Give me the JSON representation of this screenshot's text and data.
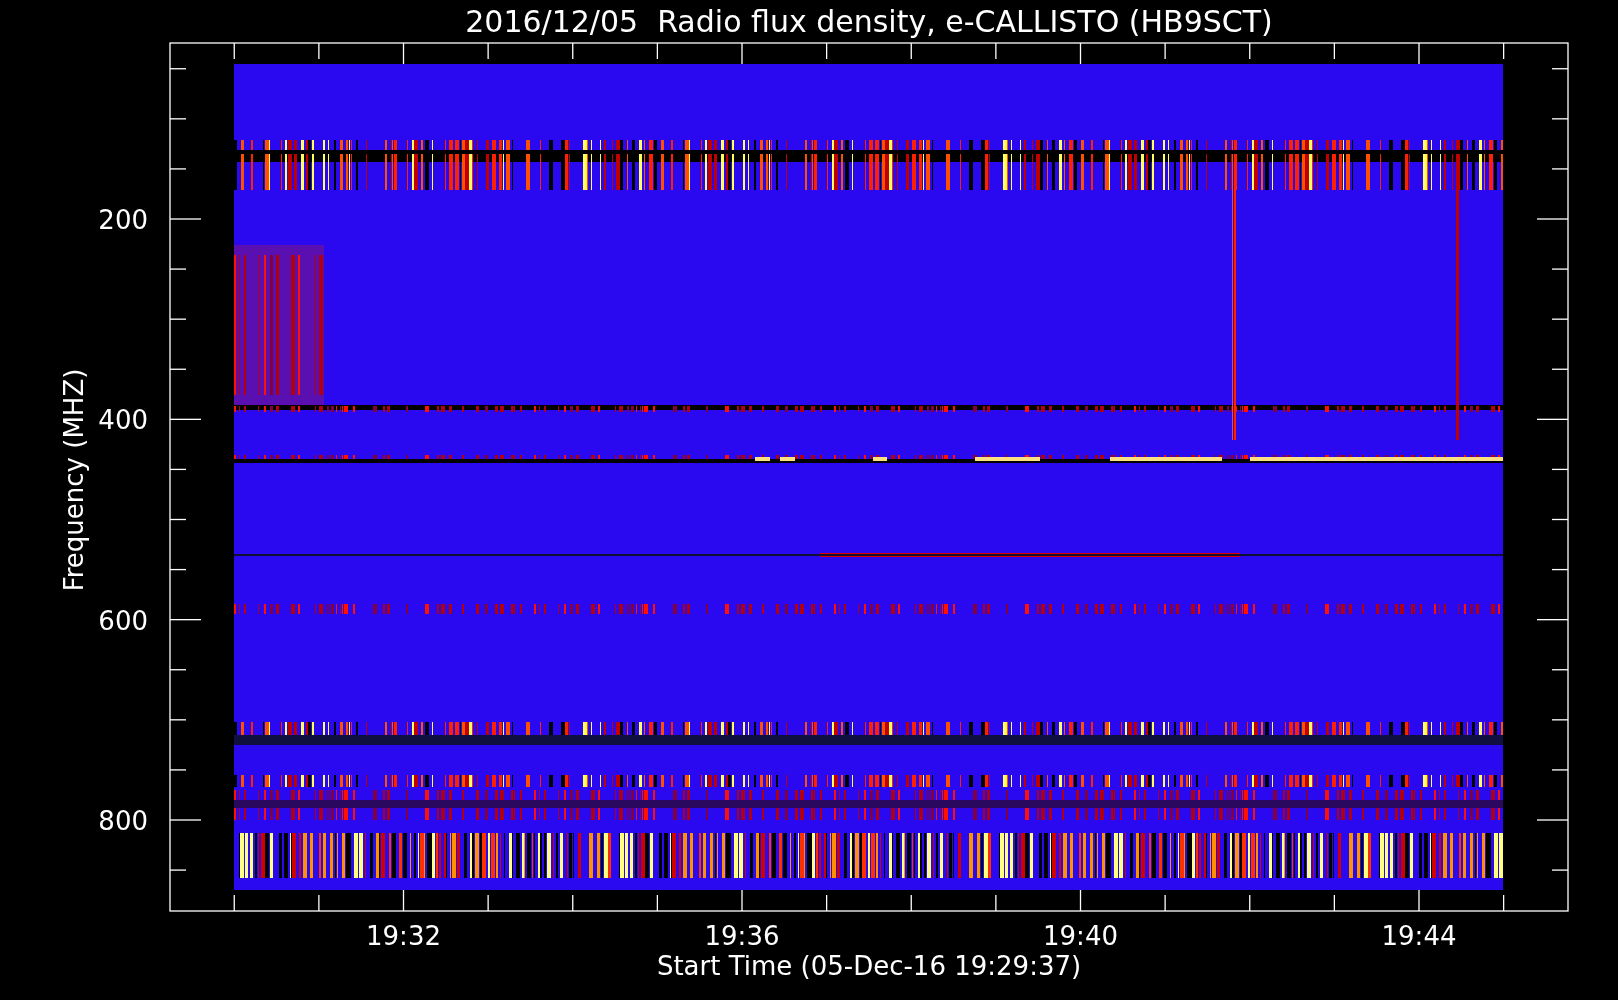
{
  "title": "2016/12/05  Radio flux density, e-CALLISTO (HB9SCT)",
  "y_axis": {
    "label": "Frequency (MHZ)",
    "tick_labels": [
      "200",
      "400",
      "600",
      "800"
    ]
  },
  "x_axis": {
    "label": "Start Time (05-Dec-16 19:29:37)",
    "tick_labels": [
      "19:32",
      "19:36",
      "19:40",
      "19:44"
    ]
  }
}
